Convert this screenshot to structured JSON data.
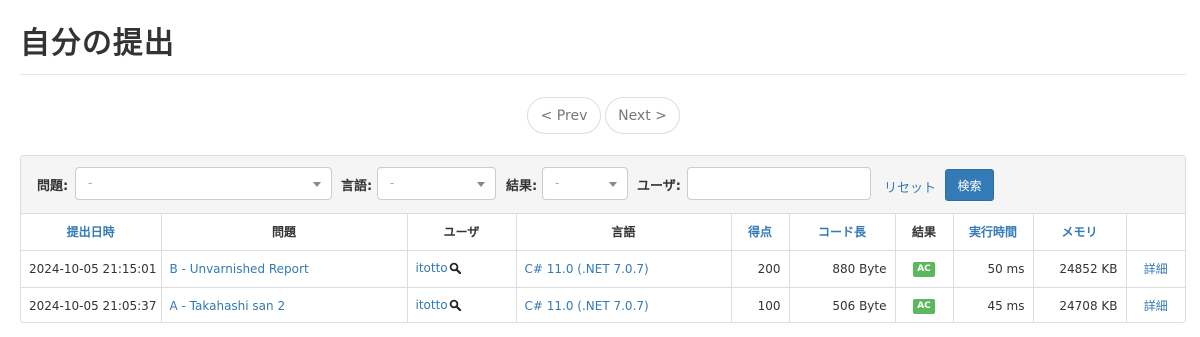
{
  "page": {
    "title": "自分の提出"
  },
  "pager": {
    "prev_label": "< Prev",
    "next_label": "Next >"
  },
  "filters": {
    "problem_label": "問題:",
    "problem_value": "-",
    "language_label": "言語:",
    "language_value": "-",
    "result_label": "結果:",
    "result_value": "-",
    "user_label": "ユーザ:",
    "user_value": "",
    "reset_label": "リセット",
    "search_label": "検索"
  },
  "table": {
    "headers": {
      "submitted_at": "提出日時",
      "problem": "問題",
      "user": "ユーザ",
      "language": "言語",
      "score": "得点",
      "code_length": "コード長",
      "result": "結果",
      "exec_time": "実行時間",
      "memory": "メモリ",
      "detail": ""
    },
    "rows": [
      {
        "submitted_at": "2024-10-05 21:15:01",
        "problem": "B - Unvarnished Report",
        "user": "itotto",
        "language": "C# 11.0 (.NET 7.0.7)",
        "score": "200",
        "code_length": "880 Byte",
        "result": "AC",
        "exec_time": "50 ms",
        "memory": "24852 KB",
        "detail": "詳細"
      },
      {
        "submitted_at": "2024-10-05 21:05:37",
        "problem": "A - Takahashi san 2",
        "user": "itotto",
        "language": "C# 11.0 (.NET 7.0.7)",
        "score": "100",
        "code_length": "506 Byte",
        "result": "AC",
        "exec_time": "45 ms",
        "memory": "24708 KB",
        "detail": "詳細"
      }
    ]
  },
  "colors": {
    "link": "#337ab7",
    "accepted": "#5cb85c",
    "primary_button": "#337ab7"
  },
  "icons": {
    "user_search": "magnifier-icon",
    "dropdown": "caret-down-icon"
  }
}
